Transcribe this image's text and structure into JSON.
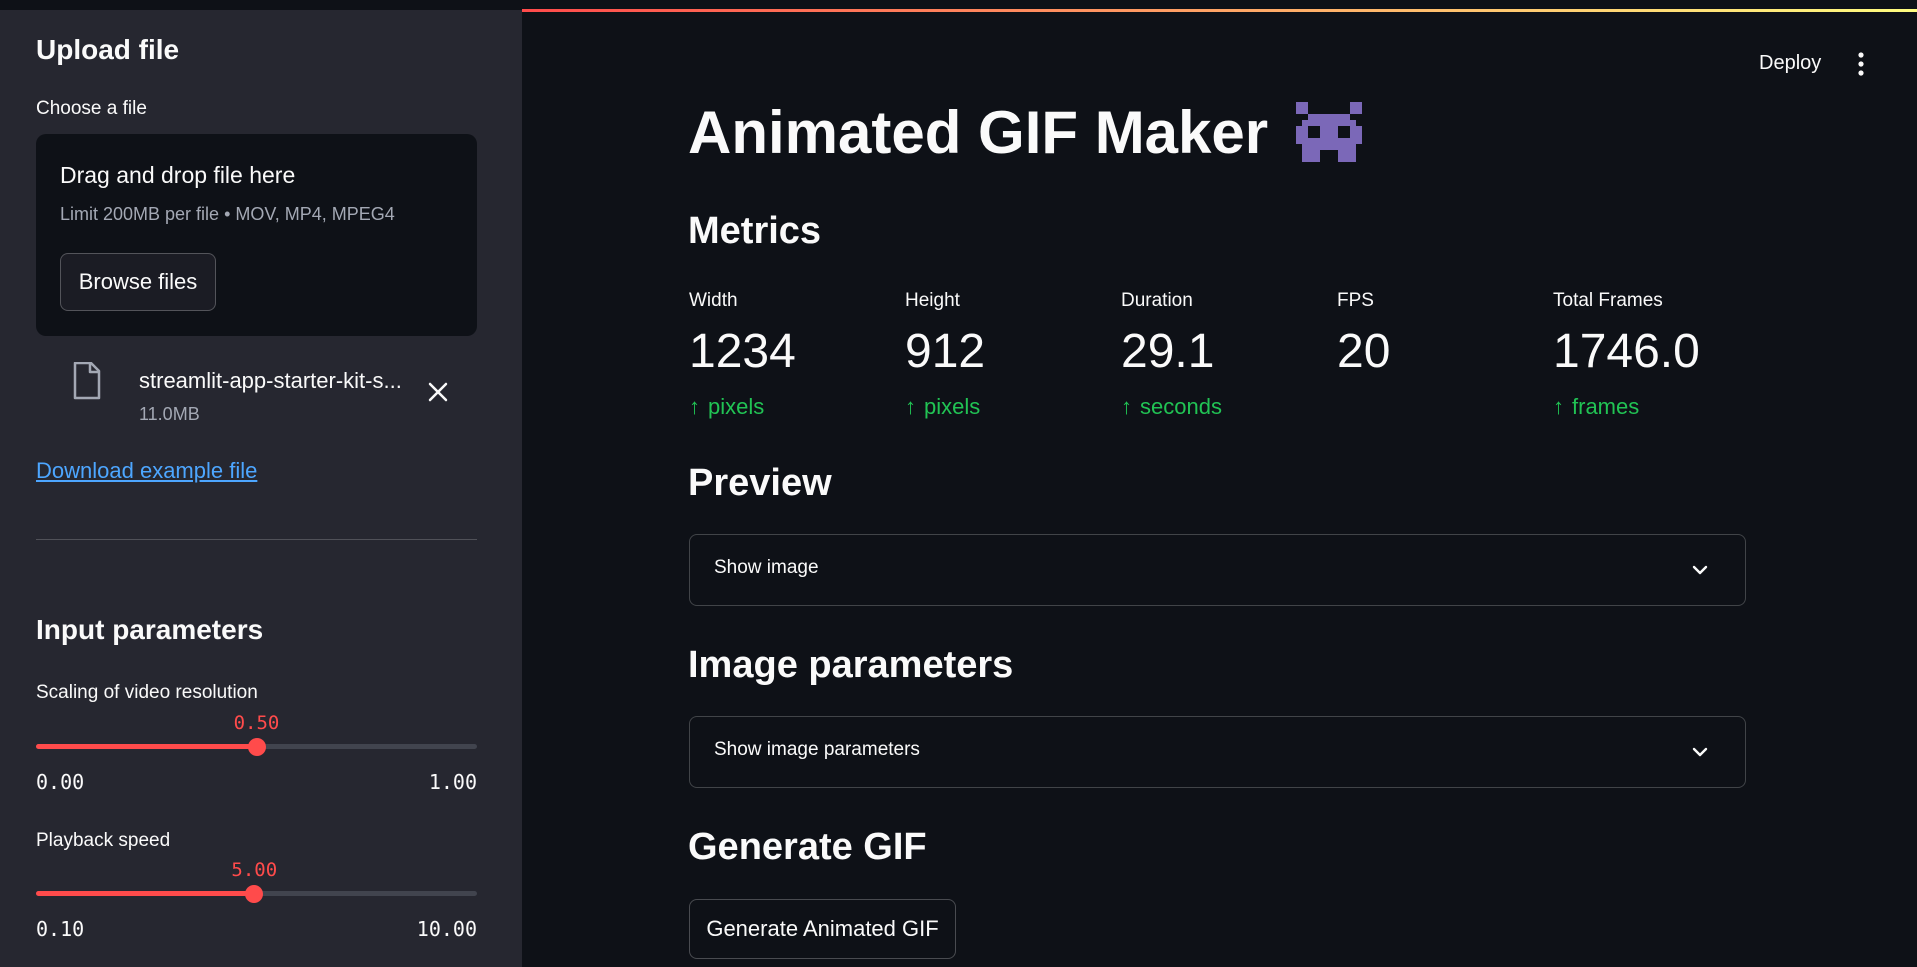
{
  "sidebar": {
    "upload_heading": "Upload file",
    "choose_label": "Choose a file",
    "dropzone": {
      "title": "Drag and drop file here",
      "limit": "Limit 200MB per file • MOV, MP4, MPEG4",
      "browse_label": "Browse files"
    },
    "file": {
      "name": "streamlit-app-starter-kit-s...",
      "size": "11.0MB"
    },
    "download_link": "Download example file",
    "input_heading": "Input parameters",
    "sliders": [
      {
        "label": "Scaling of video resolution",
        "value": "0.50",
        "min": "0.00",
        "max": "1.00",
        "fraction": 0.5
      },
      {
        "label": "Playback speed",
        "value": "5.00",
        "min": "0.10",
        "max": "10.00",
        "fraction": 0.495
      }
    ]
  },
  "header": {
    "deploy_label": "Deploy"
  },
  "main": {
    "title": "Animated GIF Maker",
    "metrics_heading": "Metrics",
    "metrics": [
      {
        "label": "Width",
        "value": "1234",
        "delta": "pixels"
      },
      {
        "label": "Height",
        "value": "912",
        "delta": "pixels"
      },
      {
        "label": "Duration",
        "value": "29.1",
        "delta": "seconds"
      },
      {
        "label": "FPS",
        "value": "20",
        "delta": ""
      },
      {
        "label": "Total Frames",
        "value": "1746.0",
        "delta": "frames"
      }
    ],
    "preview_heading": "Preview",
    "preview_expander": "Show image",
    "image_params_heading": "Image parameters",
    "image_params_expander": "Show image parameters",
    "generate_heading": "Generate GIF",
    "generate_button": "Generate Animated GIF"
  },
  "colors": {
    "accent": "#ff4b4b",
    "delta_positive": "#21c354",
    "link": "#4da6ff",
    "sidebar_bg": "#262730",
    "main_bg": "#0e1117"
  }
}
